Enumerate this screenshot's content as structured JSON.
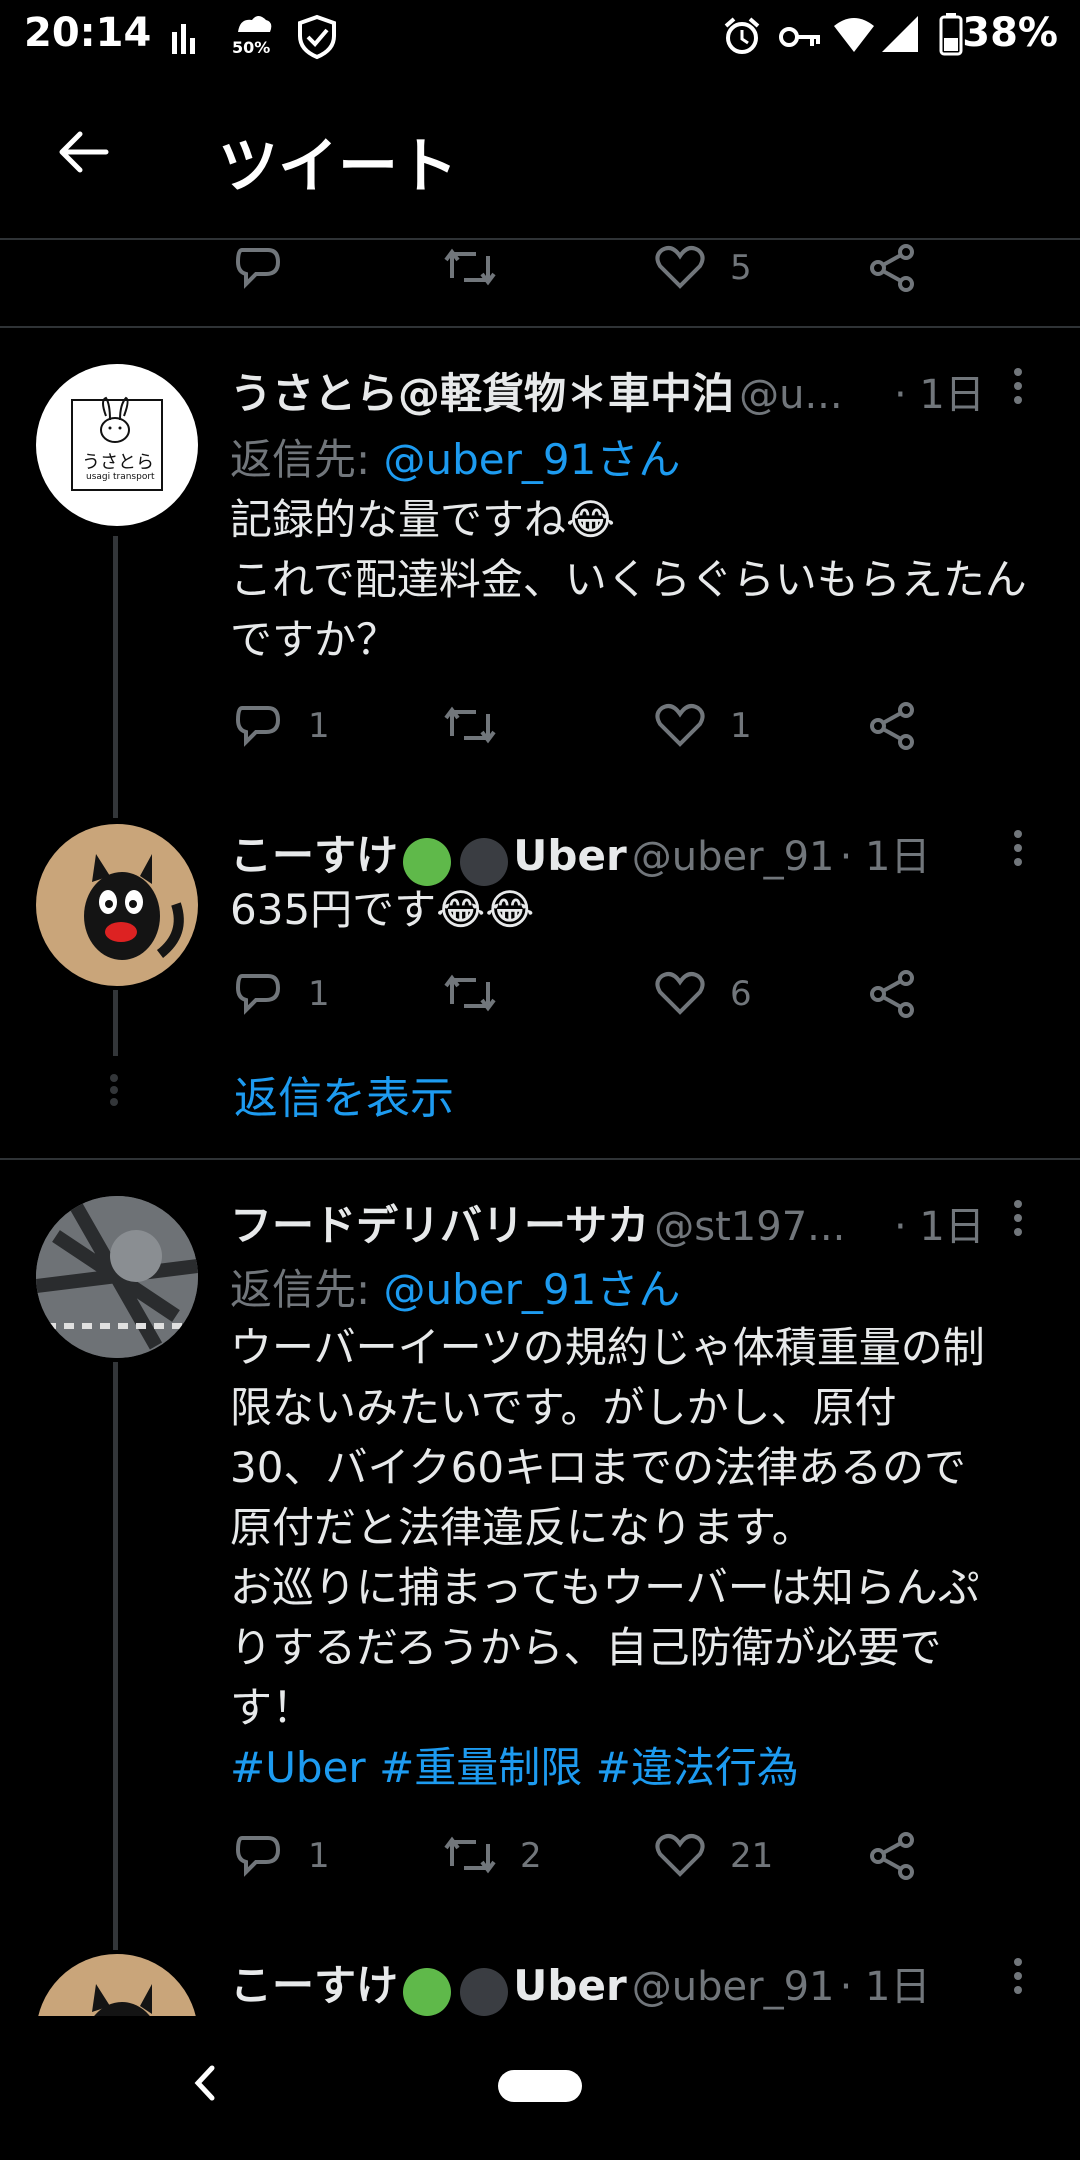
{
  "status_bar": {
    "time": "20:14",
    "data_saver": "50%",
    "battery": "38%"
  },
  "header": {
    "title": "ツイート"
  },
  "top_actions": {
    "like_count": "5"
  },
  "tweets": [
    {
      "name": "うさとら@軽貨物＊車中泊",
      "handle": "@u...",
      "time": "· 1日",
      "reply_to_prefix": "返信先: ",
      "reply_to": "@uber_91さん",
      "text_line1": "記録的な量ですね😂",
      "text_rest": "これで配達料金、いくらぐらいもらえたんですか？",
      "reply_count": "1",
      "retweet_count": "",
      "like_count": "1",
      "avatar_text": "うさとら",
      "avatar_subtext": "usagi transport"
    },
    {
      "name": "こーすけ",
      "name_suffix": "Uber",
      "handle": "@uber_91",
      "time": "· 1日",
      "text": "635円です😂😂",
      "reply_count": "1",
      "retweet_count": "",
      "like_count": "6",
      "show_replies": "返信を表示"
    },
    {
      "name": "フードデリバリーサカ",
      "handle": "@st197...",
      "time": "· 1日",
      "reply_to_prefix": "返信先: ",
      "reply_to": "@uber_91さん",
      "lines": [
        "ウーバーイーツの規約じゃ体積重量の制",
        "限ないみたいです。がしかし、原付",
        "30、バイク60キロまでの法律あるので",
        "原付だと法律違反になります。",
        "お巡りに捕まってもウーバーは知らんぷ",
        "りするだろうから、自己防衛が必要で",
        "す！"
      ],
      "hashtags": [
        "#Uber",
        "#重量制限",
        "#違法行為"
      ],
      "reply_count": "1",
      "retweet_count": "2",
      "like_count": "21"
    },
    {
      "name": "こーすけ",
      "name_suffix": "Uber",
      "handle": "@uber_91",
      "time": "· 1日"
    }
  ],
  "colors": {
    "background": "#000000",
    "text": "#e7e9ea",
    "secondary": "#71767b",
    "link": "#1d9bf0",
    "divider": "#2f3336",
    "green_dot": "#5fb94a",
    "dark_dot": "#3a3d42"
  }
}
